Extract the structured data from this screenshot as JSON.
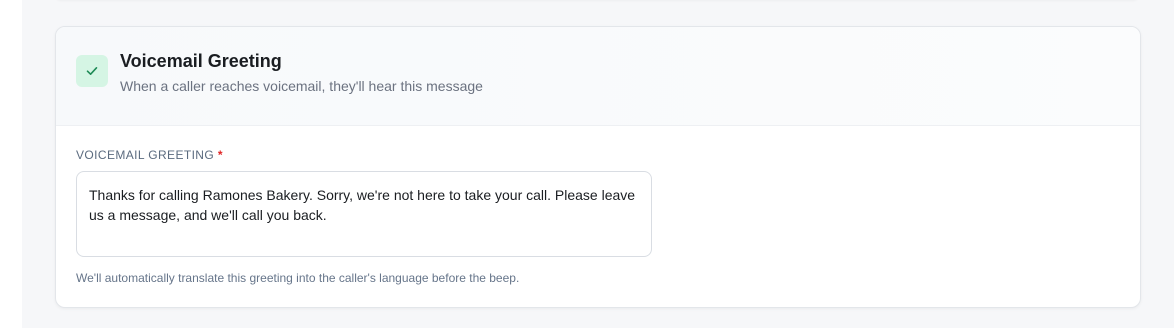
{
  "voicemail": {
    "title": "Voicemail Greeting",
    "subtitle": "When a caller reaches voicemail, they'll hear this message",
    "icon": "check-icon",
    "field_label": "VOICEMAIL GREETING",
    "required_marker": "*",
    "greeting_text": "Thanks for calling Ramones Bakery. Sorry, we're not here to take your call. Please leave us a message, and we'll call you back.",
    "helper_text": "We'll automatically translate this greeting into the caller's language before the beep."
  },
  "colors": {
    "badge_bg": "#d5f5e4",
    "check": "#1f8a56",
    "required": "#e02424"
  }
}
